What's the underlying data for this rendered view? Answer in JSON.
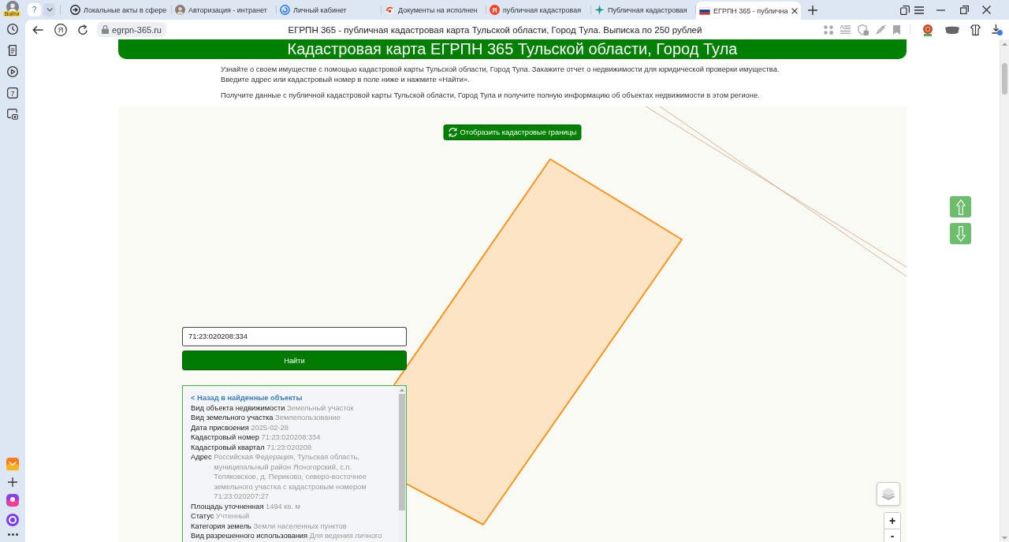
{
  "browser": {
    "profile_badge": "Войти",
    "tab_group_glyph": "?",
    "tabs": [
      {
        "title": "Локальные акты в сфере",
        "kind": "arrow",
        "selected": false
      },
      {
        "title": "Авторизация - интранет",
        "kind": "avatar",
        "selected": false
      },
      {
        "title": "Личный кабинет",
        "kind": "spiral",
        "selected": false
      },
      {
        "title": "Документы на исполнен",
        "kind": "logo",
        "selected": false
      },
      {
        "title": "публичная кадастровая",
        "kind": "letter",
        "glyph": "Я",
        "selected": false
      },
      {
        "title": "Публичная кадастровая",
        "kind": "sparkle",
        "selected": false
      },
      {
        "title": "ЕГРПН 365 - публична",
        "kind": "flag",
        "selected": true
      }
    ],
    "address_bar": {
      "yandex_glyph": "Я",
      "url": "egrpn-365.ru",
      "page_title": "ЕГРПН 365 - публичная кадастровая карта Тульской области, Город Тула. Выписка по 250 рублей"
    },
    "sidebar": {
      "calendar_day": "7"
    }
  },
  "page": {
    "heading": "Кадастровая карта ЕГРПН 365 Тульской области, Город Тула",
    "intro": [
      "Узнайте о своем имуществе с помощью кадастровой карты Тульской области, Город Тула. Закажите отчет о недвижимости для юридической проверки имущества. Введите адрес или кадастровый номер в поле ниже и нажмите «Найти».",
      "Получите данные с публичной кадастровой карты Тульской области, Город Тула и получите полную информацию об объектах недвижимости в этом регионе."
    ],
    "map": {
      "boundaries_button": "Отобразить кадастровые границы",
      "zoom_in": "+",
      "zoom_out": "-"
    },
    "search": {
      "value": "71:23:020208:334",
      "button": "Найти"
    },
    "object_info": {
      "back_link": "< Назад в найденные объекты",
      "properties": [
        {
          "label": "Вид объекта недвижимости",
          "value": "Земельный участок"
        },
        {
          "label": "Вид земельного участка",
          "value": "Землепользование"
        },
        {
          "label": "Дата присвоения",
          "value": "2025-02-28"
        },
        {
          "label": "Кадастровый номер",
          "value": "71:23:020208:334"
        },
        {
          "label": "Кадастровый квартал",
          "value": "71:23:020208"
        },
        {
          "label": "Адрес",
          "value": "Российская Федерация, Тульская область, муниципальный район Ясногорский, с.п. Теляковское, д. Периково, северо-восточнее земельного участка с кадастровым номером 71:23:020207:27"
        },
        {
          "label": "Площадь уточненная",
          "value": "1494 кв. м"
        },
        {
          "label": "Статус",
          "value": "Учтенный"
        },
        {
          "label": "Категория земель",
          "value": "Земли населенных пунктов"
        },
        {
          "label": "Вид разрешенного использования",
          "value": "Для ведения личного"
        }
      ]
    }
  }
}
